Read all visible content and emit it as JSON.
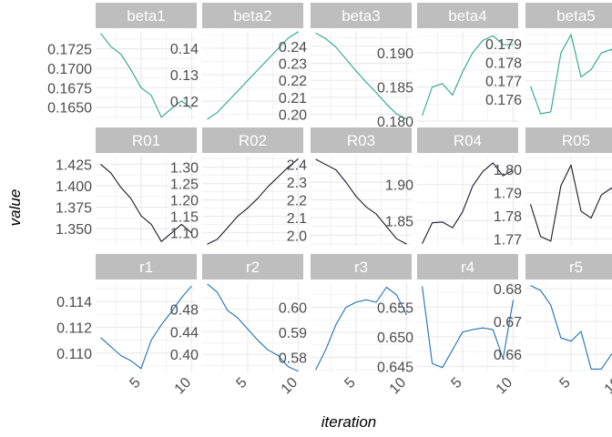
{
  "chart_data": {
    "type": "line",
    "layout": "facet_wrap",
    "xlabel": "iteration",
    "ylabel": "value",
    "x": [
      1,
      2,
      3,
      4,
      5,
      6,
      7,
      8,
      9,
      10
    ],
    "x_ticks": [
      5,
      10
    ],
    "grid": true,
    "legend": "none",
    "colors": {
      "strip_bg": "#bebebe",
      "grid": "#ebebeb",
      "beta": "#2ca58d",
      "R": "#1a1a2e",
      "r": "#2171b5"
    },
    "panels": [
      {
        "strip": "beta1",
        "group": "beta",
        "values": [
          0.1745,
          0.1728,
          0.1718,
          0.1698,
          0.1675,
          0.1665,
          0.1637,
          0.1648,
          0.1658,
          0.1648
        ],
        "ylim": [
          0.1632,
          0.1748
        ],
        "y_ticks": [
          {
            "v": 0.165,
            "label": "0.1650"
          },
          {
            "v": 0.1675,
            "label": "0.1675"
          },
          {
            "v": 0.17,
            "label": "0.1700"
          },
          {
            "v": 0.1725,
            "label": "0.1725"
          }
        ]
      },
      {
        "strip": "beta2",
        "group": "beta",
        "values": [
          0.1132,
          0.1158,
          0.1198,
          0.1238,
          0.1278,
          0.1318,
          0.1358,
          0.1398,
          0.1438,
          0.1462
        ],
        "ylim": [
          0.1125,
          0.1465
        ],
        "y_ticks": [
          {
            "v": 0.12,
            "label": "0.12"
          },
          {
            "v": 0.13,
            "label": "0.13"
          },
          {
            "v": 0.14,
            "label": "0.14"
          }
        ]
      },
      {
        "strip": "beta3",
        "group": "beta",
        "values": [
          0.2478,
          0.2445,
          0.2395,
          0.2325,
          0.2255,
          0.2188,
          0.2128,
          0.206,
          0.2002,
          0.1972
        ],
        "ylim": [
          0.196,
          0.249
        ],
        "y_ticks": [
          {
            "v": 0.2,
            "label": "0.20"
          },
          {
            "v": 0.21,
            "label": "0.21"
          },
          {
            "v": 0.22,
            "label": "0.22"
          },
          {
            "v": 0.23,
            "label": "0.23"
          },
          {
            "v": 0.24,
            "label": "0.24"
          }
        ]
      },
      {
        "strip": "beta4",
        "group": "beta",
        "values": [
          0.1808,
          0.185,
          0.1855,
          0.1838,
          0.1872,
          0.19,
          0.1918,
          0.1925,
          0.1912,
          0.1912
        ],
        "ylim": [
          0.18,
          0.1932
        ],
        "y_ticks": [
          {
            "v": 0.18,
            "label": "0.180"
          },
          {
            "v": 0.185,
            "label": "0.185"
          },
          {
            "v": 0.19,
            "label": "0.190"
          }
        ]
      },
      {
        "strip": "beta5",
        "group": "beta",
        "values": [
          0.1767,
          0.1752,
          0.1753,
          0.1785,
          0.1795,
          0.1772,
          0.1776,
          0.1785,
          0.1787,
          0.1778
        ],
        "ylim": [
          0.1748,
          0.1797
        ],
        "y_ticks": [
          {
            "v": 0.176,
            "label": "0.176"
          },
          {
            "v": 0.177,
            "label": "0.177"
          },
          {
            "v": 0.178,
            "label": "0.178"
          },
          {
            "v": 0.179,
            "label": "0.179"
          }
        ]
      },
      {
        "strip": "R01",
        "group": "R",
        "values": [
          1.425,
          1.415,
          1.398,
          1.385,
          1.365,
          1.355,
          1.335,
          1.345,
          1.355,
          1.345
        ],
        "ylim": [
          1.33,
          1.435
        ],
        "y_ticks": [
          {
            "v": 1.35,
            "label": "1.350"
          },
          {
            "v": 1.375,
            "label": "1.375"
          },
          {
            "v": 1.4,
            "label": "1.400"
          },
          {
            "v": 1.425,
            "label": "1.425"
          }
        ]
      },
      {
        "strip": "R02",
        "group": "R",
        "values": [
          1.065,
          1.08,
          1.115,
          1.15,
          1.175,
          1.205,
          1.24,
          1.27,
          1.3,
          1.325
        ],
        "ylim": [
          1.06,
          1.335
        ],
        "y_ticks": [
          {
            "v": 1.1,
            "label": "1.10"
          },
          {
            "v": 1.15,
            "label": "1.15"
          },
          {
            "v": 1.2,
            "label": "1.20"
          },
          {
            "v": 1.25,
            "label": "1.25"
          },
          {
            "v": 1.3,
            "label": "1.30"
          }
        ]
      },
      {
        "strip": "R03",
        "group": "R",
        "values": [
          2.43,
          2.4,
          2.37,
          2.3,
          2.22,
          2.16,
          2.12,
          2.05,
          1.98,
          1.95
        ],
        "ylim": [
          1.94,
          2.45
        ],
        "y_ticks": [
          {
            "v": 2.0,
            "label": "2.0"
          },
          {
            "v": 2.1,
            "label": "2.1"
          },
          {
            "v": 2.2,
            "label": "2.2"
          },
          {
            "v": 2.3,
            "label": "2.3"
          },
          {
            "v": 2.4,
            "label": "2.4"
          }
        ]
      },
      {
        "strip": "R04",
        "group": "R",
        "values": [
          1.818,
          1.847,
          1.848,
          1.84,
          1.862,
          1.898,
          1.918,
          1.93,
          1.912,
          1.92
        ],
        "ylim": [
          1.815,
          1.94
        ],
        "y_ticks": [
          {
            "v": 1.85,
            "label": "1.85"
          },
          {
            "v": 1.9,
            "label": "1.90"
          }
        ]
      },
      {
        "strip": "R05",
        "group": "R",
        "values": [
          1.785,
          1.771,
          1.769,
          1.793,
          1.802,
          1.782,
          1.779,
          1.789,
          1.792,
          1.787
        ],
        "ylim": [
          1.767,
          1.806
        ],
        "y_ticks": [
          {
            "v": 1.77,
            "label": "1.77"
          },
          {
            "v": 1.78,
            "label": "1.78"
          },
          {
            "v": 1.79,
            "label": "1.79"
          },
          {
            "v": 1.8,
            "label": "1.80"
          }
        ]
      },
      {
        "strip": "r1",
        "group": "r",
        "values": [
          0.1112,
          0.1105,
          0.1098,
          0.1094,
          0.1088,
          0.111,
          0.1122,
          0.1132,
          0.1143,
          0.1152
        ],
        "ylim": [
          0.1085,
          0.1155
        ],
        "y_ticks": [
          {
            "v": 0.11,
            "label": "0.110"
          },
          {
            "v": 0.112,
            "label": "0.112"
          },
          {
            "v": 0.114,
            "label": "0.114"
          }
        ]
      },
      {
        "strip": "r2",
        "group": "r",
        "values": [
          0.525,
          0.51,
          0.478,
          0.465,
          0.445,
          0.425,
          0.408,
          0.398,
          0.378,
          0.37
        ],
        "ylim": [
          0.368,
          0.528
        ],
        "y_ticks": [
          {
            "v": 0.4,
            "label": "0.40"
          },
          {
            "v": 0.44,
            "label": "0.44"
          },
          {
            "v": 0.48,
            "label": "0.48"
          }
        ]
      },
      {
        "strip": "r3",
        "group": "r",
        "values": [
          0.575,
          0.583,
          0.593,
          0.6,
          0.602,
          0.603,
          0.602,
          0.608,
          0.605,
          0.597
        ],
        "ylim": [
          0.574,
          0.61
        ],
        "y_ticks": [
          {
            "v": 0.58,
            "label": "0.58"
          },
          {
            "v": 0.59,
            "label": "0.59"
          },
          {
            "v": 0.6,
            "label": "0.60"
          }
        ]
      },
      {
        "strip": "r4",
        "group": "r",
        "values": [
          0.6585,
          0.6455,
          0.6448,
          0.6478,
          0.6508,
          0.6512,
          0.6515,
          0.6512,
          0.6463,
          0.6562
        ],
        "ylim": [
          0.644,
          0.6592
        ],
        "y_ticks": [
          {
            "v": 0.645,
            "label": "0.645"
          },
          {
            "v": 0.65,
            "label": "0.650"
          },
          {
            "v": 0.655,
            "label": "0.655"
          }
        ]
      },
      {
        "strip": "r5",
        "group": "r",
        "values": [
          0.681,
          0.6795,
          0.675,
          0.665,
          0.664,
          0.667,
          0.6555,
          0.6555,
          0.66,
          0.661
        ],
        "ylim": [
          0.6545,
          0.682
        ],
        "y_ticks": [
          {
            "v": 0.66,
            "label": "0.66"
          },
          {
            "v": 0.67,
            "label": "0.67"
          },
          {
            "v": 0.68,
            "label": "0.68"
          }
        ]
      }
    ]
  }
}
